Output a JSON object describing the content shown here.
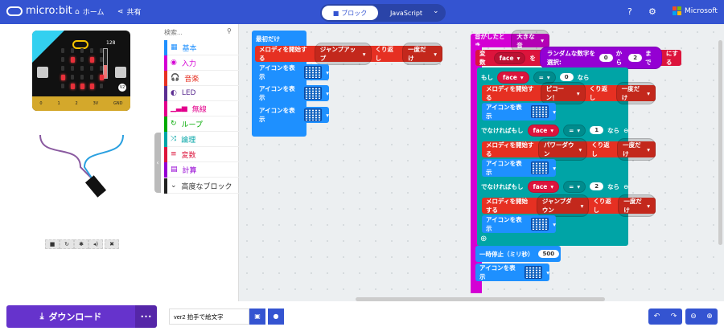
{
  "header": {
    "logo": "micro:bit",
    "home": "ホーム",
    "share": "共有",
    "tab_block": "ブロック",
    "tab_js": "JavaScript",
    "microsoft": "Microsoft",
    "icons": [
      "help-icon",
      "gear-icon"
    ]
  },
  "simulator": {
    "light_level": "128",
    "pins": [
      "0",
      "1",
      "2",
      "3V",
      "GND"
    ],
    "version": "V2",
    "leds": [
      [
        0,
        0,
        0,
        0,
        0
      ],
      [
        0,
        1,
        0,
        1,
        0
      ],
      [
        0,
        0,
        0,
        0,
        0
      ],
      [
        1,
        0,
        0,
        0,
        1
      ],
      [
        0,
        1,
        1,
        1,
        0
      ]
    ]
  },
  "toolbox": {
    "search_placeholder": "検索...",
    "categories": [
      {
        "label": "基本",
        "color": "#1e90ff",
        "icon": "▦"
      },
      {
        "label": "入力",
        "color": "#d400d4",
        "icon": "◉"
      },
      {
        "label": "音楽",
        "color": "#e63022",
        "icon": "🎧"
      },
      {
        "label": "LED",
        "color": "#5c2d91",
        "icon": "◐"
      },
      {
        "label": "無線",
        "color": "#e3008c",
        "icon": "▁▃▅"
      },
      {
        "label": "ループ",
        "color": "#00aa00",
        "icon": "↻"
      },
      {
        "label": "論理",
        "color": "#00a4a6",
        "icon": "⤨"
      },
      {
        "label": "変数",
        "color": "#dc143c",
        "icon": "≡"
      },
      {
        "label": "計算",
        "color": "#9400d3",
        "icon": "▤"
      }
    ],
    "advanced": "高度なブロック"
  },
  "blocks": {
    "on_start": "最初だけ",
    "melody": "メロディを開始する",
    "repeat": "くり返し",
    "once": "一度だけ",
    "show_icon": "アイコンを表示",
    "jump_up": "ジャンプアップ",
    "on_sound": "音がしたとき",
    "loud": "大きな音",
    "var": "変数",
    "face": "face",
    "wo": "を",
    "random": "ランダムな数字を選択:",
    "from": "から",
    "to": "まで",
    "set": "にする",
    "r0": "0",
    "r2": "2",
    "if": "もし",
    "eq": "=",
    "then": "なら",
    "v0": "0",
    "v1": "1",
    "v2": "2",
    "elseif": "でなければもし",
    "piko": "ピコーン！",
    "power_down": "パワーダウン",
    "jump_down": "ジャンプダウン",
    "pause": "一時停止（ミリ秒）",
    "ms": "500"
  },
  "bottom": {
    "download": "ダウンロード",
    "more": "•••",
    "project_name": "ver2 拍手で絵文字"
  }
}
